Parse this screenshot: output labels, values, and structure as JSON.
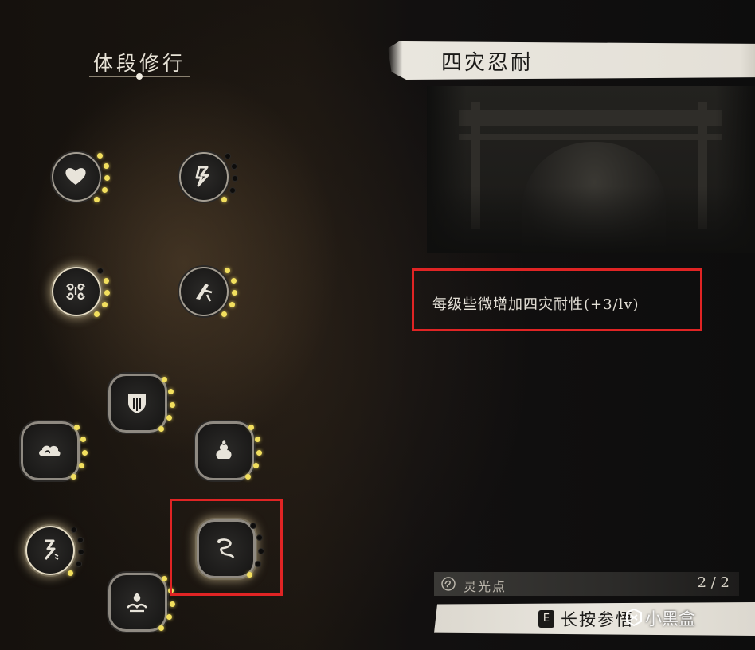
{
  "tree": {
    "title": "体段修行",
    "nodes": [
      {
        "id": "heart",
        "icon": "heart-icon",
        "level": 5,
        "max": 5
      },
      {
        "id": "rune-a",
        "icon": "lightning-rune-icon",
        "level": 1,
        "max": 5
      },
      {
        "id": "swirl",
        "icon": "swirl-pattern-icon",
        "level": 4,
        "max": 5
      },
      {
        "id": "blade",
        "icon": "blade-rune-icon",
        "level": 5,
        "max": 5
      },
      {
        "id": "shield",
        "icon": "shield-mask-icon",
        "level": 5,
        "max": 5
      },
      {
        "id": "cloud",
        "icon": "cloud-icon",
        "level": 5,
        "max": 5
      },
      {
        "id": "flame-gourd",
        "icon": "flame-gourd-icon",
        "level": 5,
        "max": 5
      },
      {
        "id": "rune-b",
        "icon": "rune-glyph-icon",
        "level": 1,
        "max": 5
      },
      {
        "id": "dragon",
        "icon": "dragon-icon",
        "level": 1,
        "max": 5
      },
      {
        "id": "crown",
        "icon": "crown-cloud-icon",
        "level": 5,
        "max": 5
      }
    ]
  },
  "detail": {
    "title": "四灾忍耐",
    "description": "每级些微增加四灾耐性(+3/lv)"
  },
  "points": {
    "icon": "spirit-light-icon",
    "label": "灵光点",
    "value": "2 / 2"
  },
  "action": {
    "key": "E",
    "label": "长按参悟"
  },
  "watermark": {
    "icon": "xiaoheihe-logo",
    "text": "小黑盒"
  },
  "colors": {
    "highlight": "#e02424",
    "level_dot": "#f2df5e",
    "band": "#e6e2d9"
  }
}
